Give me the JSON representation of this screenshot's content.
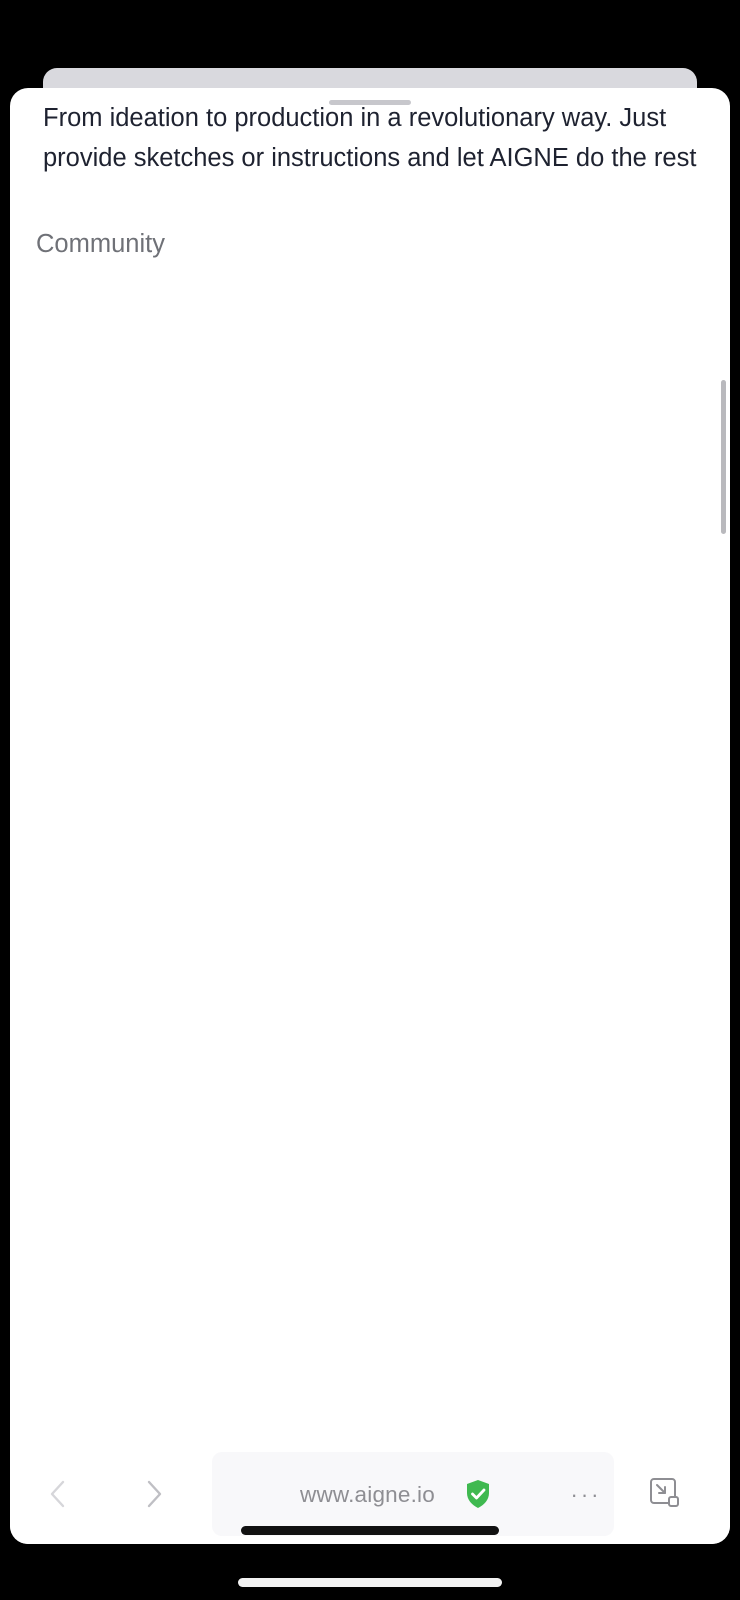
{
  "content": {
    "intro_text": "From ideation to production in a revolutionary way. Just provide sketches or instructions and let AIGNE do the rest",
    "community_label": "Community"
  },
  "toolbar": {
    "url": "www.aigne.io",
    "more_label": "···",
    "icons": {
      "back": "chevron-left-icon",
      "forward": "chevron-right-icon",
      "secure": "shield-check-icon",
      "more": "ellipsis-icon",
      "minimize": "minimize-window-icon"
    }
  },
  "colors": {
    "text_primary": "#1e2230",
    "text_secondary": "#6f7177",
    "secure_green": "#3fb950",
    "toolbar_icon": "#8e8e93"
  }
}
